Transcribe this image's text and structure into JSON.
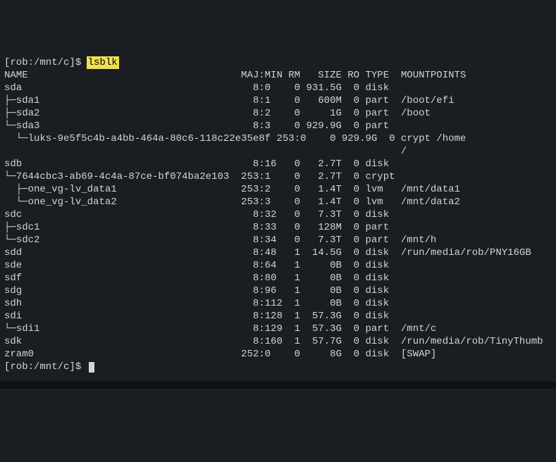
{
  "prompt1": {
    "prefix": "[rob:/mnt/c]$ ",
    "command": "lsblk"
  },
  "header": "NAME                                    MAJ:MIN RM   SIZE RO TYPE  MOUNTPOINTS",
  "rows": [
    "sda                                       8:0    0 931.5G  0 disk  ",
    "├─sda1                                    8:1    0   600M  0 part  /boot/efi",
    "├─sda2                                    8:2    0     1G  0 part  /boot",
    "└─sda3                                    8:3    0 929.9G  0 part  ",
    "  └─luks-9e5f5c4b-a4bb-464a-80c6-118c22e35e8f 253:0    0 929.9G  0 crypt /home",
    "                                                                   /",
    "sdb                                       8:16   0   2.7T  0 disk  ",
    "└─7644cbc3-ab69-4c4a-87ce-bf074ba2e103  253:1    0   2.7T  0 crypt ",
    "  ├─one_vg-lv_data1                     253:2    0   1.4T  0 lvm   /mnt/data1",
    "  └─one_vg-lv_data2                     253:3    0   1.4T  0 lvm   /mnt/data2",
    "sdc                                       8:32   0   7.3T  0 disk  ",
    "├─sdc1                                    8:33   0   128M  0 part  ",
    "└─sdc2                                    8:34   0   7.3T  0 part  /mnt/h",
    "sdd                                       8:48   1  14.5G  0 disk  /run/media/rob/PNY16GB",
    "sde                                       8:64   1     0B  0 disk  ",
    "sdf                                       8:80   1     0B  0 disk  ",
    "sdg                                       8:96   1     0B  0 disk  ",
    "sdh                                       8:112  1     0B  0 disk  ",
    "sdi                                       8:128  1  57.3G  0 disk  ",
    "└─sdi1                                    8:129  1  57.3G  0 part  /mnt/c",
    "sdk                                       8:160  1  57.7G  0 disk  /run/media/rob/TinyThumb",
    "zram0                                   252:0    0     8G  0 disk  [SWAP]"
  ],
  "prompt2": {
    "prefix": "[rob:/mnt/c]$ "
  }
}
